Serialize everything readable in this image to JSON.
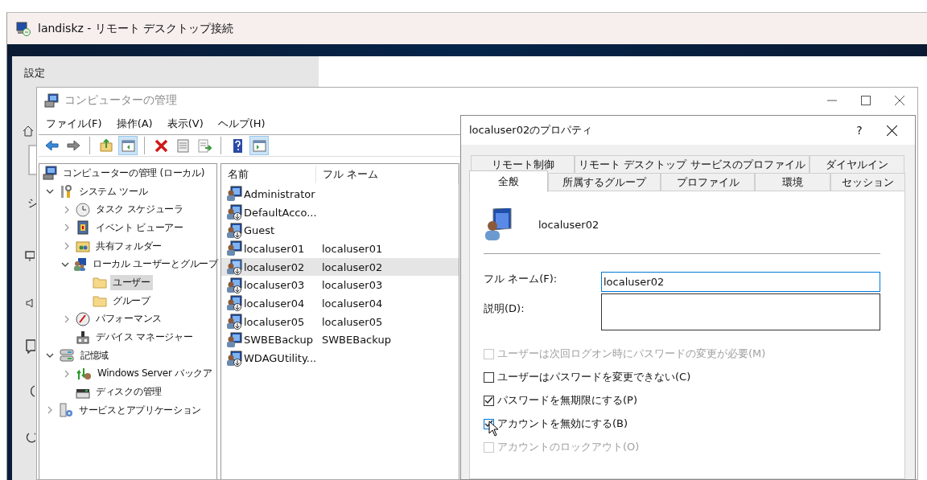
{
  "rdp_window": {
    "title": "landiskz - リモート デスクトップ接続"
  },
  "settings_window": {
    "title": "設定",
    "sidebar_text": "シ"
  },
  "mmc_window": {
    "title": "コンピューターの管理",
    "menu": [
      "ファイル(F)",
      "操作(A)",
      "表示(V)",
      "ヘルプ(H)"
    ],
    "toolbar": [
      {
        "selected": false
      },
      {
        "selected": false
      },
      {
        "selected": false
      },
      {
        "selected": true
      },
      {
        "selected": false
      },
      {
        "selected": false
      },
      {
        "selected": false
      },
      {
        "selected": false
      },
      {
        "selected": true
      }
    ],
    "tree": [
      {
        "label": "コンピューターの管理 (ローカル)",
        "children": [
          {
            "label": "システム ツール",
            "expanded": true,
            "children": [
              {
                "label": "タスク スケジューラ",
                "expanded": false,
                "selected": false
              },
              {
                "label": "イベント ビューアー",
                "expanded": false,
                "selected": false
              },
              {
                "label": "共有フォルダー",
                "expanded": false,
                "selected": false
              },
              {
                "label": "ローカル ユーザーとグループ",
                "expanded": true,
                "selected": false,
                "children": [
                  {
                    "label": "ユーザー",
                    "selected": true
                  },
                  {
                    "label": "グループ",
                    "selected": false
                  }
                ]
              },
              {
                "label": "パフォーマンス",
                "expanded": false,
                "selected": false
              },
              {
                "label": "デバイス マネージャー",
                "selected": false
              }
            ]
          },
          {
            "label": "記憶域",
            "expanded": true,
            "children": [
              {
                "label": "Windows Server バックア",
                "expanded": false,
                "selected": false
              },
              {
                "label": "ディスクの管理",
                "selected": false
              }
            ]
          },
          {
            "label": "サービスとアプリケーション",
            "expanded": false
          }
        ]
      }
    ],
    "list": {
      "columns": [
        "名前",
        "フル ネーム"
      ],
      "rows": [
        {
          "name": "Administrator",
          "disabled": false,
          "selected": false
        },
        {
          "name": "DefaultAcco...",
          "disabled": true,
          "selected": false
        },
        {
          "name": "Guest",
          "disabled": true,
          "selected": false
        },
        {
          "name": "localuser01",
          "full_name": "localuser01",
          "disabled": false,
          "selected": false
        },
        {
          "name": "localuser02",
          "full_name": "localuser02",
          "disabled": true,
          "selected": true
        },
        {
          "name": "localuser03",
          "full_name": "localuser03",
          "disabled": true,
          "selected": false
        },
        {
          "name": "localuser04",
          "full_name": "localuser04",
          "disabled": true,
          "selected": false
        },
        {
          "name": "localuser05",
          "full_name": "localuser05",
          "disabled": true,
          "selected": false
        },
        {
          "name": "SWBEBackup",
          "full_name": "SWBEBackup",
          "disabled": false,
          "selected": false
        },
        {
          "name": "WDAGUtility...",
          "disabled": true,
          "selected": false
        }
      ]
    }
  },
  "dialog": {
    "title": "localuser02のプロパティ",
    "help": "?",
    "tabs_back": [
      {
        "label": "リモート制御",
        "selected": false
      },
      {
        "label": "リモート デスクトップ サービスのプロファイル",
        "selected": false
      },
      {
        "label": "ダイヤルイン",
        "selected": false
      }
    ],
    "tabs_front": [
      {
        "label": "全般",
        "selected": true
      },
      {
        "label": "所属するグループ",
        "selected": false
      },
      {
        "label": "プロファイル",
        "selected": false
      },
      {
        "label": "環境",
        "selected": false
      },
      {
        "label": "セッション",
        "selected": false
      }
    ],
    "username": "localuser02",
    "fields": [
      {
        "kind": "line",
        "label": "フル ネーム(F):",
        "value": "localuser02",
        "focused": true
      },
      {
        "kind": "box",
        "label": "説明(D):",
        "focused": false
      }
    ],
    "checkboxes": [
      {
        "label": "ユーザーは次回ログオン時にパスワードの変更が必要(M)",
        "checked": false,
        "disabled": true,
        "hovered": false
      },
      {
        "label": "ユーザーはパスワードを変更できない(C)",
        "checked": false,
        "disabled": false,
        "hovered": false
      },
      {
        "label": "パスワードを無期限にする(P)",
        "checked": true,
        "disabled": false,
        "hovered": false
      },
      {
        "label": "アカウントを無効にする(B)",
        "checked": true,
        "disabled": false,
        "hovered": true
      },
      {
        "label": "アカウントのロックアウト(O)",
        "checked": false,
        "disabled": true,
        "hovered": false
      }
    ]
  }
}
